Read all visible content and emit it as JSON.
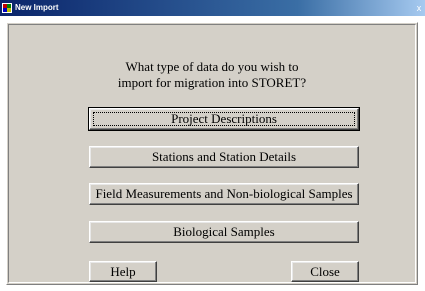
{
  "window": {
    "title": "New Import",
    "close_glyph": "x",
    "icon": "app-icon"
  },
  "prompt": {
    "line1": "What type of data do you wish to",
    "line2": "import for migration into STORET?"
  },
  "options": [
    {
      "label": "Project Descriptions",
      "default": true
    },
    {
      "label": "Stations and Station Details"
    },
    {
      "label": "Field Measurements and Non-biological Samples"
    },
    {
      "label": "Biological Samples"
    }
  ],
  "footer": {
    "help_label": "Help",
    "close_label": "Close"
  },
  "colors": {
    "titlebar_start": "#0a246a",
    "face": "#d4d0c8"
  }
}
